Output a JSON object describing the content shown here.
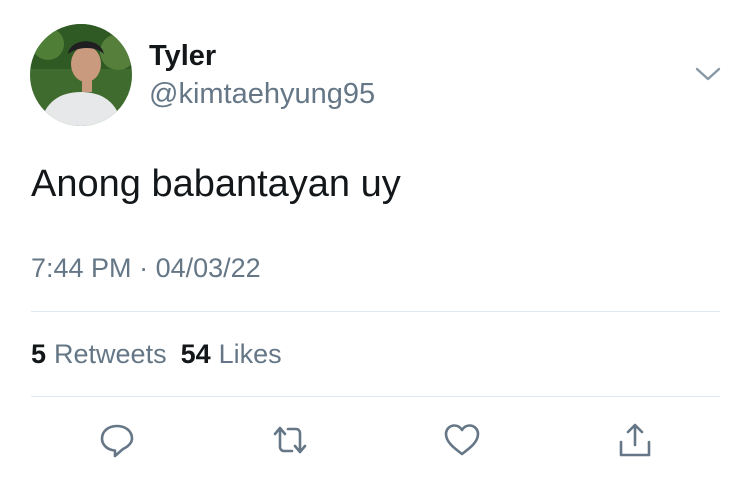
{
  "tweet": {
    "author": {
      "display_name": "Tyler",
      "handle": "@kimtaehyung95"
    },
    "text": "Anong babantayan uy",
    "time": "7:44 PM",
    "separator": "·",
    "date": "04/03/22",
    "stats": {
      "retweets_count": "5",
      "retweets_label": "Retweets",
      "likes_count": "54",
      "likes_label": "Likes"
    }
  },
  "icons": {
    "menu": "chevron-down-icon",
    "reply": "reply-icon",
    "retweet": "retweet-icon",
    "like": "heart-icon",
    "share": "share-icon"
  },
  "colors": {
    "primary_text": "#14171a",
    "secondary_text": "#657786",
    "divider": "#e1e8ed",
    "icon": "#657786"
  }
}
